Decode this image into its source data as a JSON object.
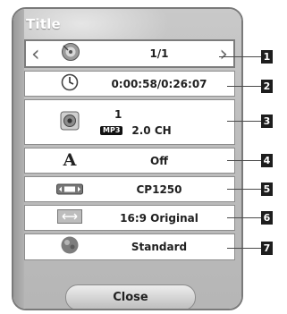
{
  "window": {
    "title": "Title"
  },
  "rows": [
    {
      "name": "title-chapter",
      "icon": "disc-icon",
      "value": "1/1"
    },
    {
      "name": "time",
      "icon": "clock-icon",
      "value": "0:00:58/0:26:07"
    },
    {
      "name": "audio",
      "icon": "speaker-icon",
      "line1": "1",
      "codec": "MP3",
      "channels": "2.0 CH"
    },
    {
      "name": "subtitle",
      "icon": "subtitle-a-icon",
      "value": "Off"
    },
    {
      "name": "code-page",
      "icon": "abc-icon",
      "value": "CP1250"
    },
    {
      "name": "tv-aspect-ratio",
      "icon": "aspect-ratio-icon",
      "value": "16:9 Original"
    },
    {
      "name": "picture-mode",
      "icon": "picture-mode-icon",
      "value": "Standard"
    }
  ],
  "close_label": "Close",
  "callouts": [
    "1",
    "2",
    "3",
    "4",
    "5",
    "6",
    "7"
  ]
}
